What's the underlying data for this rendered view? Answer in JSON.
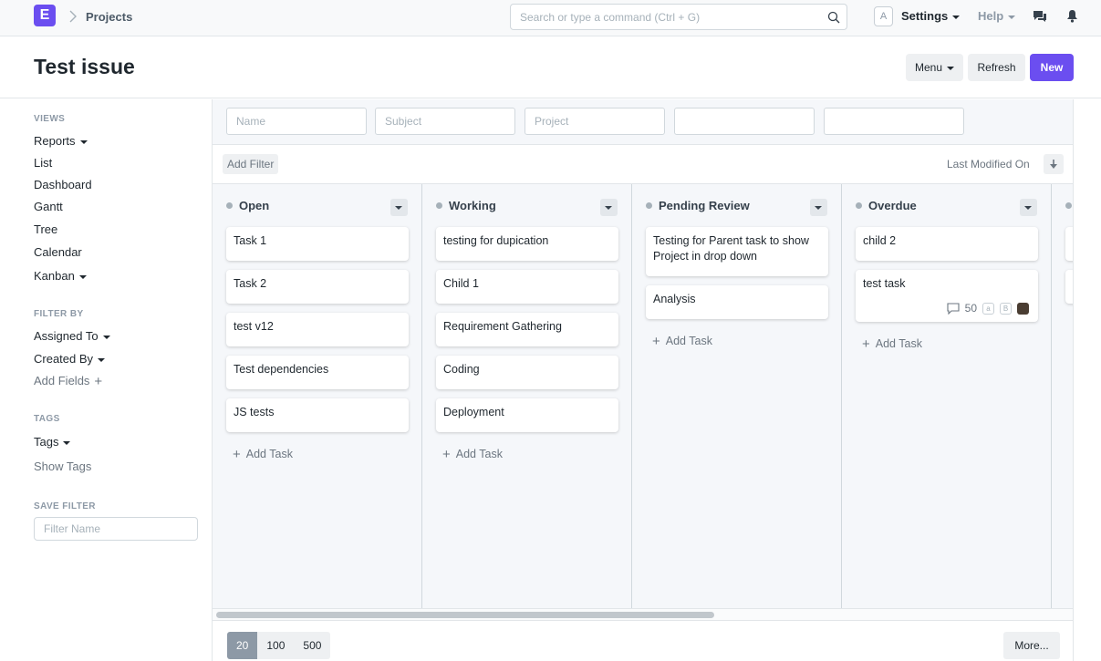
{
  "navbar": {
    "logo_letter": "E",
    "breadcrumb": "Projects",
    "search_placeholder": "Search or type a command (Ctrl + G)",
    "avatar_letter": "A",
    "settings_label": "Settings",
    "help_label": "Help"
  },
  "header": {
    "title": "Test issue",
    "menu_label": "Menu",
    "refresh_label": "Refresh",
    "new_label": "New"
  },
  "sidebar": {
    "views_heading": "VIEWS",
    "views": [
      "Reports",
      "List",
      "Dashboard",
      "Gantt",
      "Tree",
      "Calendar",
      "Kanban"
    ],
    "filter_heading": "FILTER BY",
    "assigned_to": "Assigned To",
    "created_by": "Created By",
    "add_fields": "Add Fields",
    "tags_heading": "TAGS",
    "tags": "Tags",
    "show_tags": "Show Tags",
    "save_filter_heading": "SAVE FILTER",
    "filter_name_placeholder": "Filter Name"
  },
  "filters": {
    "name_placeholder": "Name",
    "subject_placeholder": "Subject",
    "project_placeholder": "Project",
    "add_filter": "Add Filter",
    "sort_by": "Last Modified On"
  },
  "kanban": {
    "add_task": "Add Task",
    "columns": [
      {
        "title": "Open",
        "cards": [
          "Task 1",
          "Task 2",
          "test v12",
          "Test dependencies",
          "JS tests"
        ]
      },
      {
        "title": "Working",
        "cards": [
          "testing for dupication",
          "Child 1",
          "Requirement Gathering",
          "Coding",
          "Deployment"
        ]
      },
      {
        "title": "Pending Review",
        "cards": [
          "Testing for Parent task to show Project in drop down",
          "Analysis"
        ]
      },
      {
        "title": "Overdue",
        "cards": [
          "child 2",
          "test task"
        ],
        "comment_count": "50",
        "assignee_a": "a",
        "assignee_b": "B"
      }
    ]
  },
  "paging": {
    "sizes": [
      "20",
      "100",
      "500"
    ],
    "more": "More..."
  }
}
